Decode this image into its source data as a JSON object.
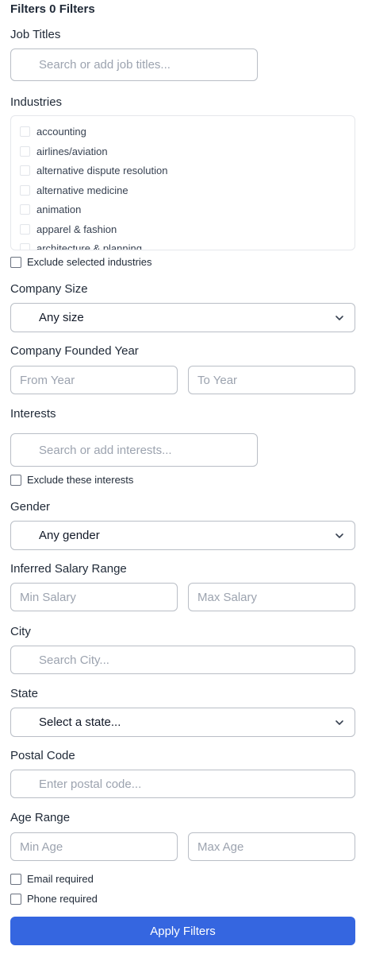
{
  "header": {
    "title": "Filters 0 Filters"
  },
  "job_titles": {
    "label": "Job Titles",
    "placeholder": "Search or add job titles..."
  },
  "industries": {
    "label": "Industries",
    "items": [
      "accounting",
      "airlines/aviation",
      "alternative dispute resolution",
      "alternative medicine",
      "animation",
      "apparel & fashion",
      "architecture & planning"
    ],
    "exclude_label": "Exclude selected industries"
  },
  "company_size": {
    "label": "Company Size",
    "value": "Any size"
  },
  "founded_year": {
    "label": "Company Founded Year",
    "from_placeholder": "From Year",
    "to_placeholder": "To Year"
  },
  "interests": {
    "label": "Interests",
    "placeholder": "Search or add interests...",
    "exclude_label": "Exclude these interests"
  },
  "gender": {
    "label": "Gender",
    "value": "Any gender"
  },
  "salary": {
    "label": "Inferred Salary Range",
    "min_placeholder": "Min Salary",
    "max_placeholder": "Max Salary"
  },
  "city": {
    "label": "City",
    "placeholder": "Search City..."
  },
  "state": {
    "label": "State",
    "value": "Select a state..."
  },
  "postal": {
    "label": "Postal Code",
    "placeholder": "Enter postal code..."
  },
  "age": {
    "label": "Age Range",
    "min_placeholder": "Min Age",
    "max_placeholder": "Max Age"
  },
  "requirements": {
    "email_label": "Email required",
    "phone_label": "Phone required"
  },
  "actions": {
    "apply_label": "Apply Filters"
  },
  "theme": {
    "primary": "#3566e0",
    "border": "#b9bec6",
    "placeholder": "#9ca3af"
  }
}
